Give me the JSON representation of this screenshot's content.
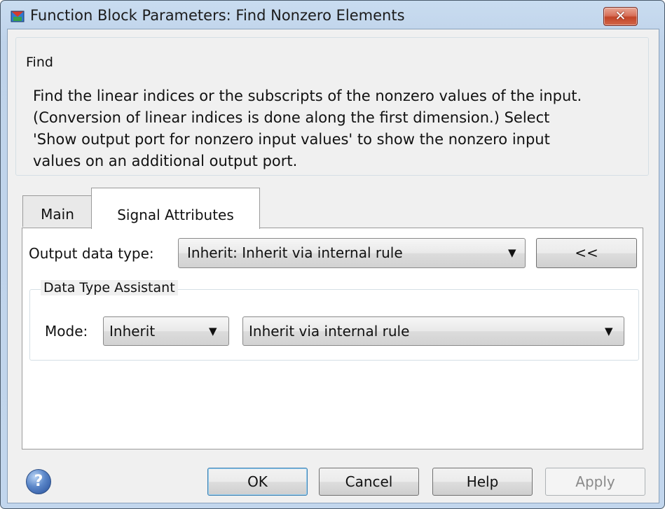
{
  "window": {
    "title": "Function Block Parameters: Find Nonzero Elements",
    "close_glyph": "✕"
  },
  "find_group": {
    "legend": "Find",
    "description_lines": [
      "Find the linear indices or the subscripts of the nonzero values of the input.",
      "(Conversion of linear indices is done along the first dimension.) Select",
      "'Show output port for nonzero input values' to show the nonzero input",
      "values on an additional output port."
    ]
  },
  "tabs": [
    {
      "label": "Main",
      "active": false
    },
    {
      "label": "Signal Attributes",
      "active": true
    }
  ],
  "signal_attributes": {
    "output_data_type_label": "Output data type:",
    "output_data_type_value": "Inherit: Inherit via internal rule",
    "assistant_toggle_label": "<<",
    "data_type_assistant": {
      "legend": "Data Type Assistant",
      "mode_label": "Mode:",
      "mode_value": "Inherit",
      "rule_value": "Inherit via internal rule"
    }
  },
  "footer": {
    "help_icon_glyph": "?",
    "buttons": {
      "ok": "OK",
      "cancel": "Cancel",
      "help": "Help",
      "apply": "Apply"
    }
  },
  "icons": {
    "dropdown_arrow": "▼"
  }
}
